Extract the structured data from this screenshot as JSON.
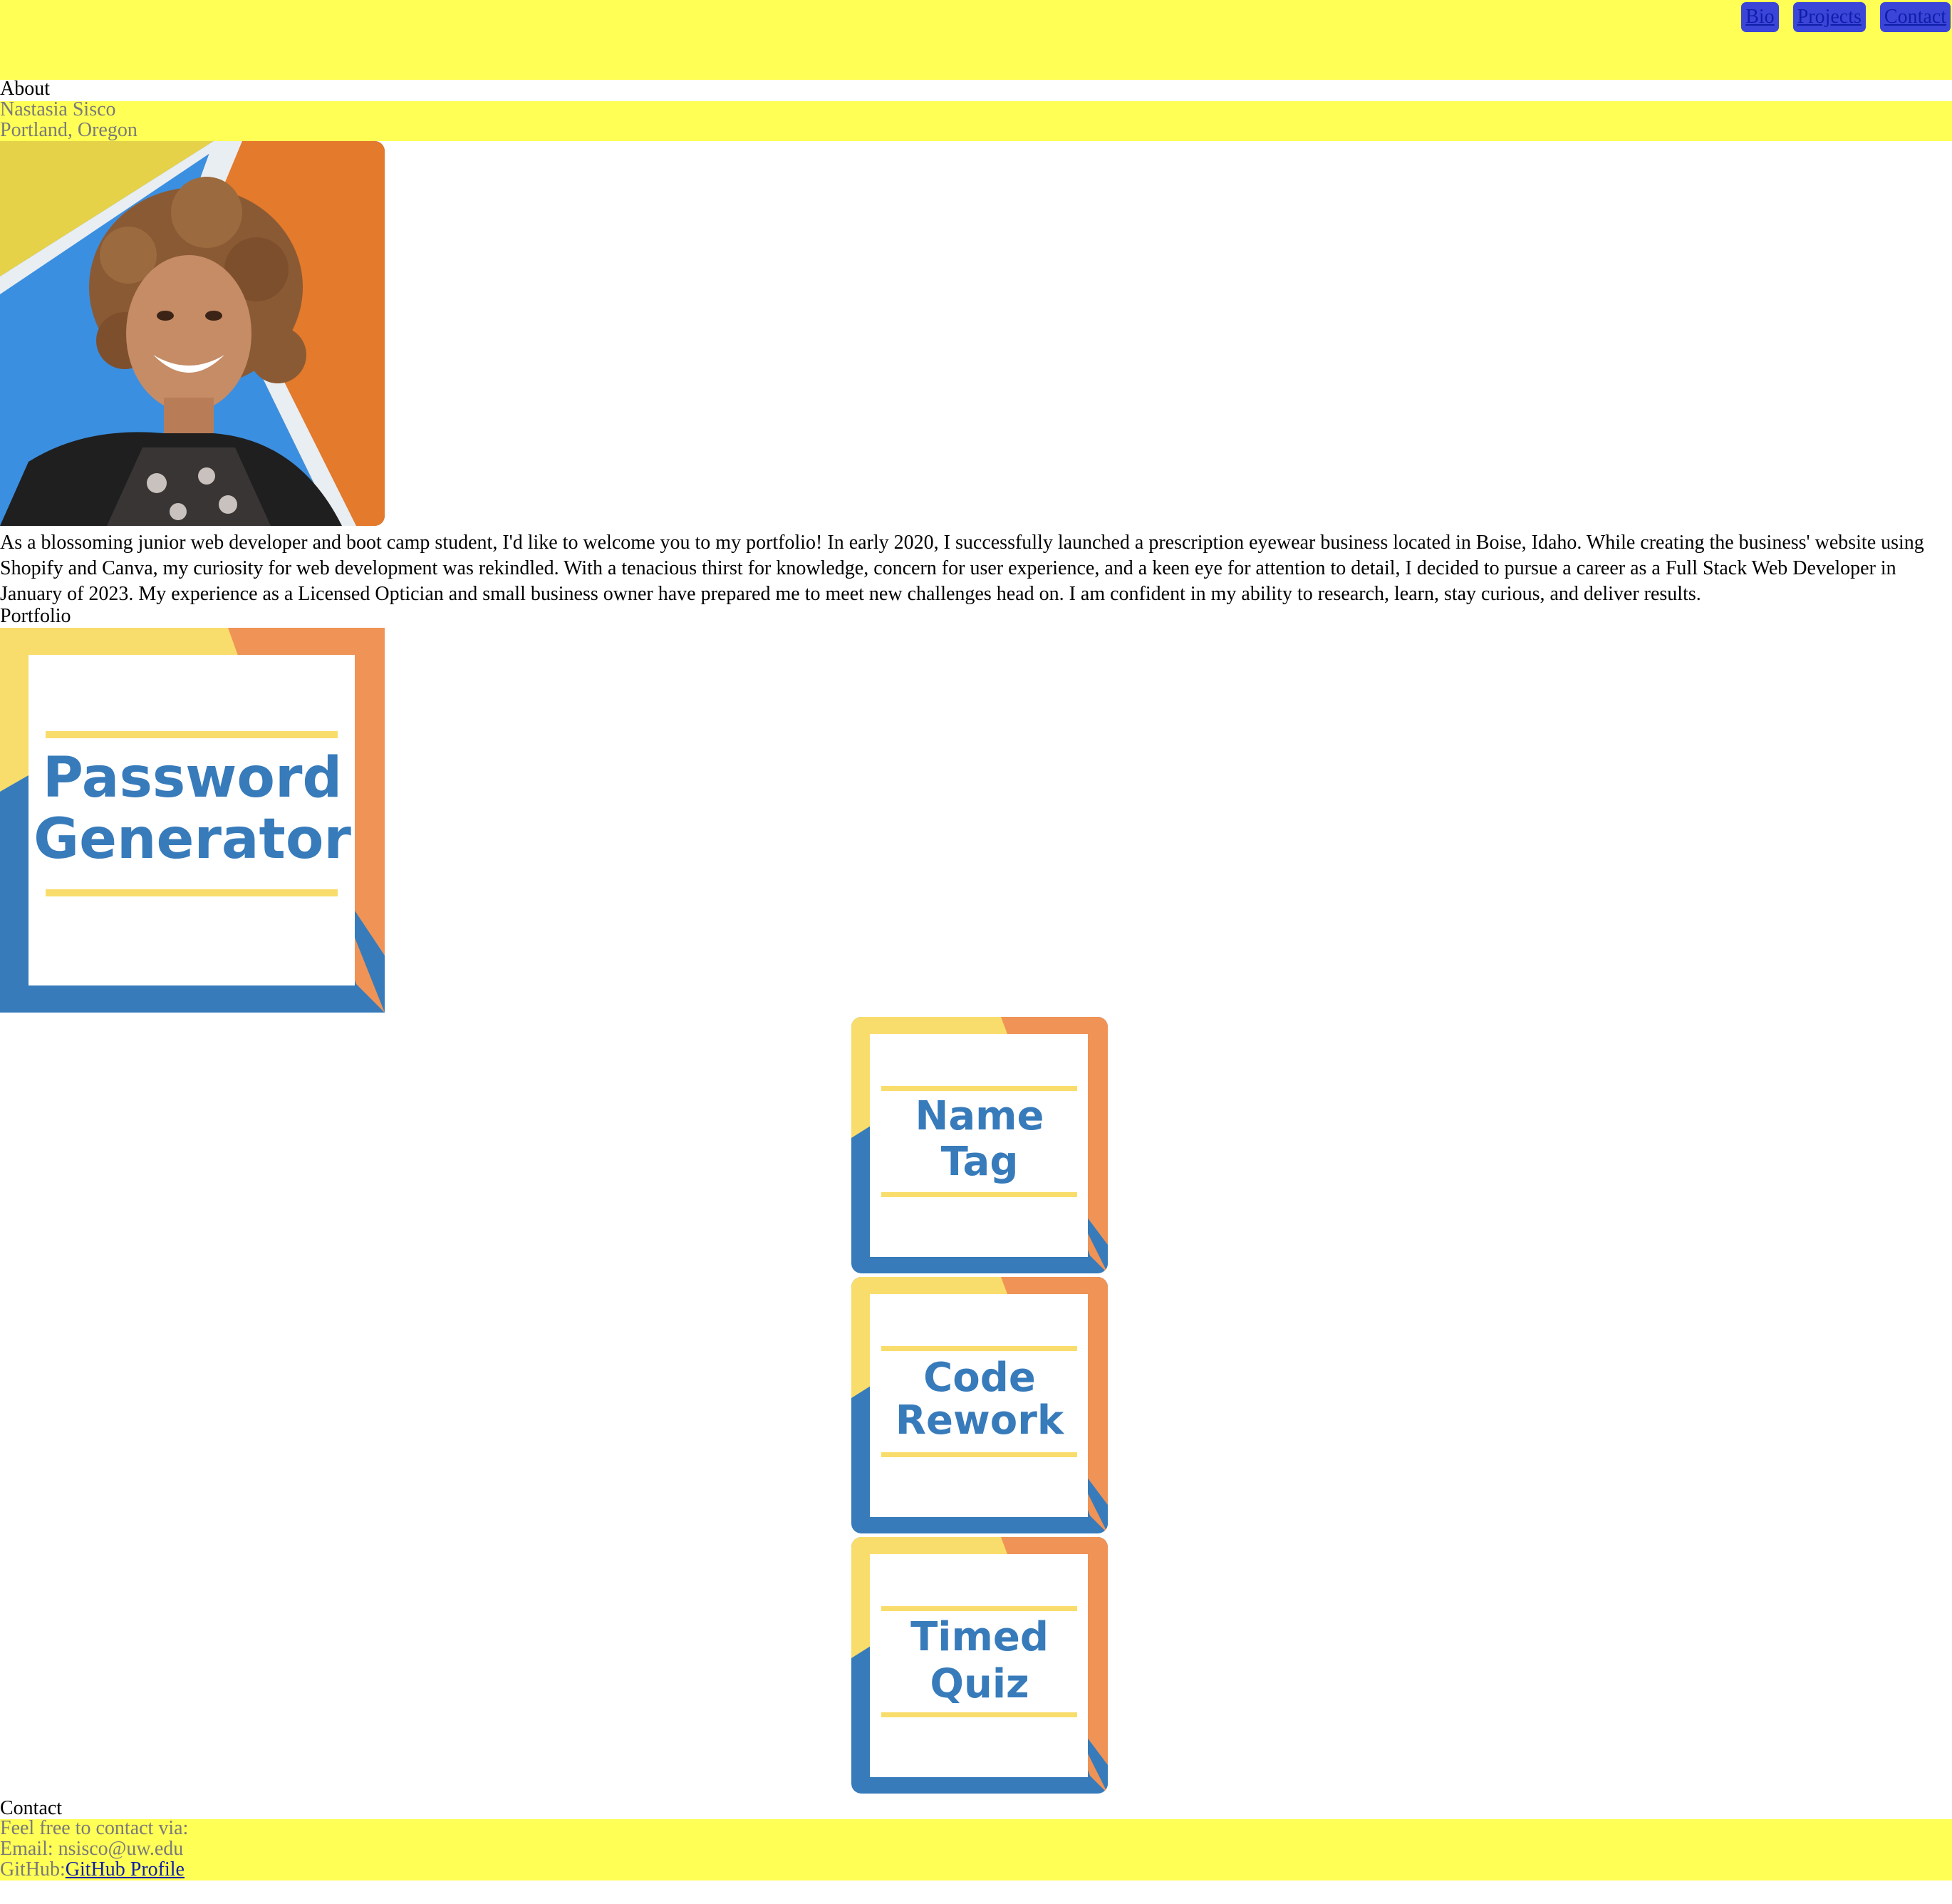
{
  "nav": {
    "items": [
      "Bio",
      "Projects",
      "Contact"
    ]
  },
  "about": {
    "heading": "About",
    "name": "Nastasia Sisco",
    "location": "Portland, Oregon",
    "bio": "As a blossoming junior web developer and boot camp student, I'd like to welcome you to my portfolio! In early 2020, I successfully launched a prescription eyewear business located in Boise, Idaho. While creating the business' website using Shopify and Canva, my curiosity for web development was rekindled. With a tenacious thirst for knowledge, concern for user experience, and a keen eye for attention to detail, I decided to pursue a career as a Full Stack Web Developer in January of 2023. My experience as a Licensed Optician and small business owner have prepared me to meet new challenges head on. I am confident in my ability to research, learn, stay curious, and deliver results."
  },
  "portfolio": {
    "heading": "Portfolio",
    "projects": [
      {
        "line1": "Password",
        "line2": "Generator"
      },
      {
        "line1": "Name",
        "line2": "Tag"
      },
      {
        "line1": "Code",
        "line2": "Rework"
      },
      {
        "line1": "Timed",
        "line2": "Quiz"
      }
    ]
  },
  "contact": {
    "heading": "Contact",
    "intro": "Feel free to contact via:",
    "email": "Email: nsisco@uw.edu",
    "github_label": "GitHub:",
    "github_link": "GitHub Profile"
  },
  "colors": {
    "highlight_yellow": "#ffff55",
    "nav_button": "#3b46d9",
    "tile_blue": "#377bbb",
    "tile_yellow": "#f9dd6c",
    "tile_orange": "#f09356"
  }
}
